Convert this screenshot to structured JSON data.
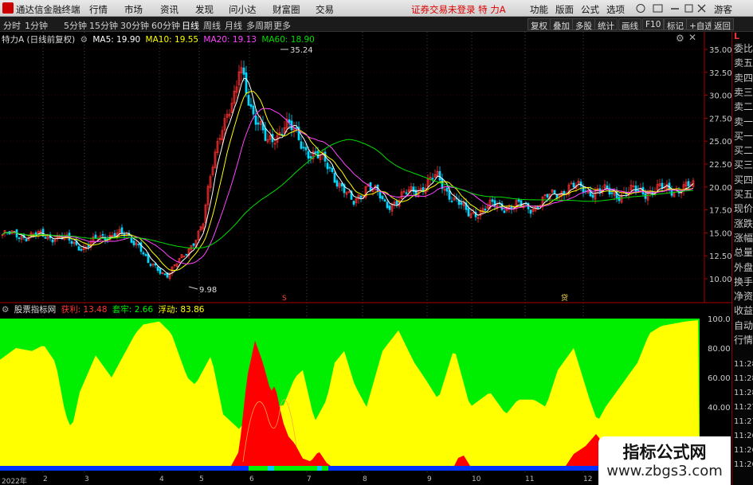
{
  "menubar": {
    "app_title": "通达信金融终端",
    "items": [
      "行情",
      "市场",
      "资讯",
      "发现",
      "问小达",
      "财富圈",
      "交易"
    ],
    "notice": "证券交易未登录",
    "stock_name": "特 力A",
    "right_items": [
      "功能",
      "版面",
      "公式",
      "选项"
    ],
    "guest": "游客"
  },
  "toolbar": {
    "periods": [
      "分时",
      "1分钟",
      "5分钟",
      "15分钟",
      "30分钟",
      "60分钟",
      "日线",
      "周线",
      "月线",
      "多周期",
      "更多"
    ],
    "active_period": "日线",
    "right_buttons": [
      "复权",
      "叠加",
      "多股",
      "统计",
      "画线",
      "F10",
      "标记",
      "+自选",
      "返回"
    ]
  },
  "main_legend": {
    "title": "特力A (日线前复权)",
    "ma5": "MA5: 19.90",
    "ma10": "MA10: 19.55",
    "ma20": "MA20: 19.13",
    "ma60": "MA60: 18.90"
  },
  "indicator_legend": {
    "title": "股票指标网",
    "profit_label": "获利: 13.48",
    "trapped_label": "套牢: 2.66",
    "float_label": "浮动: 83.86"
  },
  "price_axis": [
    "35.00",
    "32.50",
    "30.00",
    "27.50",
    "25.00",
    "22.50",
    "20.00",
    "17.50",
    "15.00",
    "12.50",
    "10.00"
  ],
  "indicator_axis": [
    "100.0",
    "80.00",
    "60.00",
    "40.00"
  ],
  "annotations": {
    "high": "35.24",
    "low": "9.98",
    "marker_s": "S",
    "marker_b": "贷"
  },
  "date_labels": [
    "2022年",
    "2",
    "3",
    "4",
    "5",
    "6",
    "7",
    "8",
    "9",
    "10",
    "11",
    "12"
  ],
  "sidebar": {
    "top_badge": "L",
    "labels": [
      "委比",
      "卖五",
      "卖四",
      "卖三",
      "卖二",
      "卖一",
      "买一",
      "买二",
      "买三",
      "买四",
      "买五",
      "现价",
      "涨跌",
      "涨幅",
      "总量",
      "外盘",
      "换手",
      "净资",
      "收益",
      "自动",
      "行情"
    ],
    "times": [
      "11:28",
      "11:28",
      "11:28",
      "11:27",
      "11:27",
      "11:26",
      "11:26",
      "11:26"
    ]
  },
  "watermark": {
    "line1": "指标公式网",
    "line2": "www.zbgs3.com"
  },
  "colors": {
    "ma5": "#ffffff",
    "ma10": "#ffff00",
    "ma20": "#ff44ff",
    "ma60": "#00dd00",
    "up": "#ff3030",
    "down": "#00d8ff",
    "green_band": "#00ee00",
    "yellow_band": "#ffff00",
    "red_band": "#ff0000"
  }
}
